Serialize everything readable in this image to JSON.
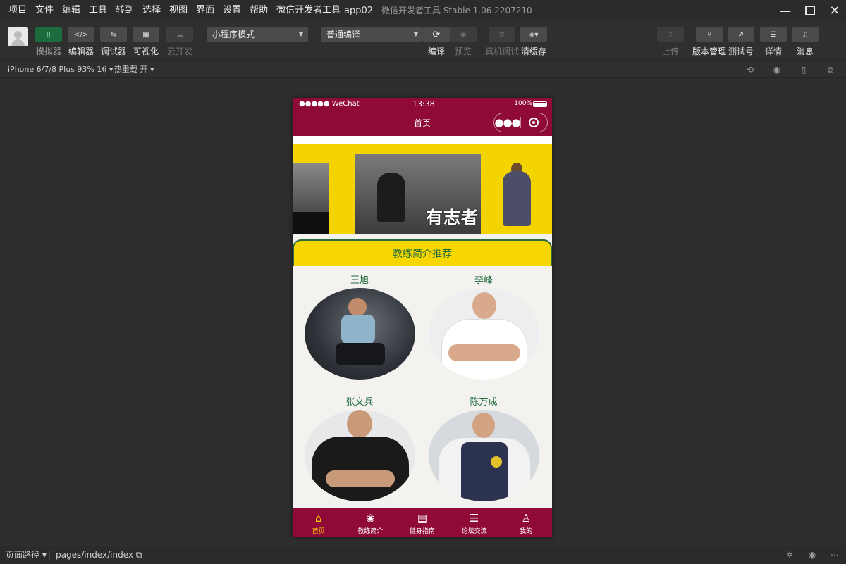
{
  "menu": [
    "项目",
    "文件",
    "编辑",
    "工具",
    "转到",
    "选择",
    "视图",
    "界面",
    "设置",
    "帮助",
    "微信开发者工具"
  ],
  "window": {
    "app": "app02",
    "title": "微信开发者工具 Stable 1.06.2207210"
  },
  "toolbar": {
    "left_buttons": [
      {
        "label": "模拟器",
        "icon": "phone-icon",
        "state": "active"
      },
      {
        "label": "编辑器",
        "icon": "code-icon",
        "state": "normal"
      },
      {
        "label": "调试器",
        "icon": "debug-icon",
        "state": "normal"
      },
      {
        "label": "可视化",
        "icon": "layout-icon",
        "state": "normal"
      },
      {
        "label": "云开发",
        "icon": "cloud-icon",
        "state": "disabled"
      }
    ],
    "mode_select": "小程序模式",
    "compile_select": "普通编译",
    "mid_buttons": [
      {
        "label": "编译",
        "icon": "refresh-icon",
        "state": "normal"
      },
      {
        "label": "预览",
        "icon": "eye-icon",
        "state": "disabled"
      },
      {
        "label": "真机调试",
        "icon": "bug-icon",
        "state": "disabled"
      },
      {
        "label": "清缓存",
        "icon": "layers-icon",
        "state": "normal"
      }
    ],
    "right_buttons": [
      {
        "label": "上传",
        "icon": "upload-icon",
        "state": "disabled"
      },
      {
        "label": "版本管理",
        "icon": "branch-icon",
        "state": "normal"
      },
      {
        "label": "测试号",
        "icon": "external-icon",
        "state": "normal"
      },
      {
        "label": "详情",
        "icon": "menu-icon",
        "state": "normal"
      },
      {
        "label": "消息",
        "icon": "bell-icon",
        "state": "normal"
      }
    ]
  },
  "subbar": {
    "device": "iPhone 6/7/8 Plus 93% 16",
    "hot_reload": "热重载 开"
  },
  "phone": {
    "status_left": "●●●●● WeChat",
    "status_time": "13:38",
    "status_battery": "100%",
    "nav_title": "首页",
    "banner_text": "有志者",
    "section_title": "教练简介推荐",
    "coaches": [
      {
        "name": "王旭"
      },
      {
        "name": "李峰"
      },
      {
        "name": "张文兵"
      },
      {
        "name": "陈万成"
      }
    ],
    "tabs": [
      {
        "label": "首页",
        "icon": "home-icon",
        "active": true
      },
      {
        "label": "教练简介",
        "icon": "grid-icon",
        "active": false
      },
      {
        "label": "健身指南",
        "icon": "calendar-icon",
        "active": false
      },
      {
        "label": "论坛交流",
        "icon": "list-icon",
        "active": false
      },
      {
        "label": "我的",
        "icon": "user-icon",
        "active": false
      }
    ]
  },
  "statusbar": {
    "path_label": "页面路径",
    "path": "pages/index/index"
  },
  "colors": {
    "nav_bg": "#8f0a36",
    "accent_yellow": "#f8d600",
    "accent_green": "#1f6b3c",
    "tab_active": "#ffd400"
  }
}
